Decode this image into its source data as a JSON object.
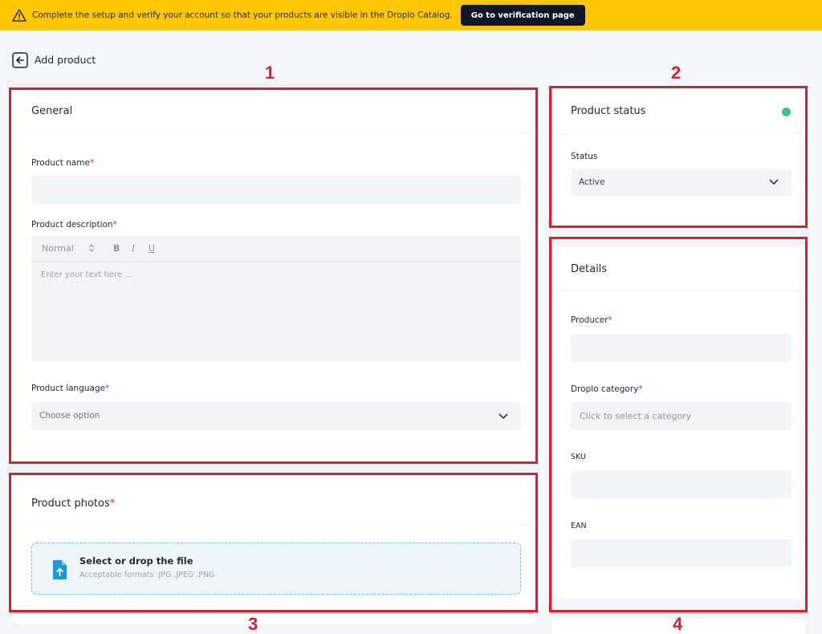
{
  "banner": {
    "message": "Complete the setup and verify your account so that your products are visible in the Droplo Catalog.",
    "button_label": "Go to verification page"
  },
  "header": {
    "title": "Add product"
  },
  "general": {
    "title": "General",
    "product_name_label": "Product name",
    "product_description_label": "Product description",
    "editor": {
      "format": "Normal",
      "bold": "B",
      "italic": "I",
      "underline": "U",
      "placeholder": "Enter your text here ..."
    },
    "product_language_label": "Product language",
    "product_language_placeholder": "Choose option"
  },
  "photos": {
    "title": "Product photos",
    "drop_title": "Select or drop the file",
    "drop_formats": "Acceptable formats .JPG .JPEG .PNG"
  },
  "status": {
    "title": "Product status",
    "status_label": "Status",
    "status_value": "Active",
    "indicator_color": "#3cc47c"
  },
  "details": {
    "title": "Details",
    "producer_label": "Producer",
    "category_label": "Droplo category",
    "category_placeholder": "Click to select a category",
    "sku_label": "SKU",
    "ean_label": "EAN"
  },
  "required_mark": "*",
  "annotations": [
    "1",
    "2",
    "3",
    "4"
  ],
  "colors": {
    "banner": "#ffc700",
    "annotation": "#e11d2a",
    "accent_blue": "#1a9ad6"
  }
}
